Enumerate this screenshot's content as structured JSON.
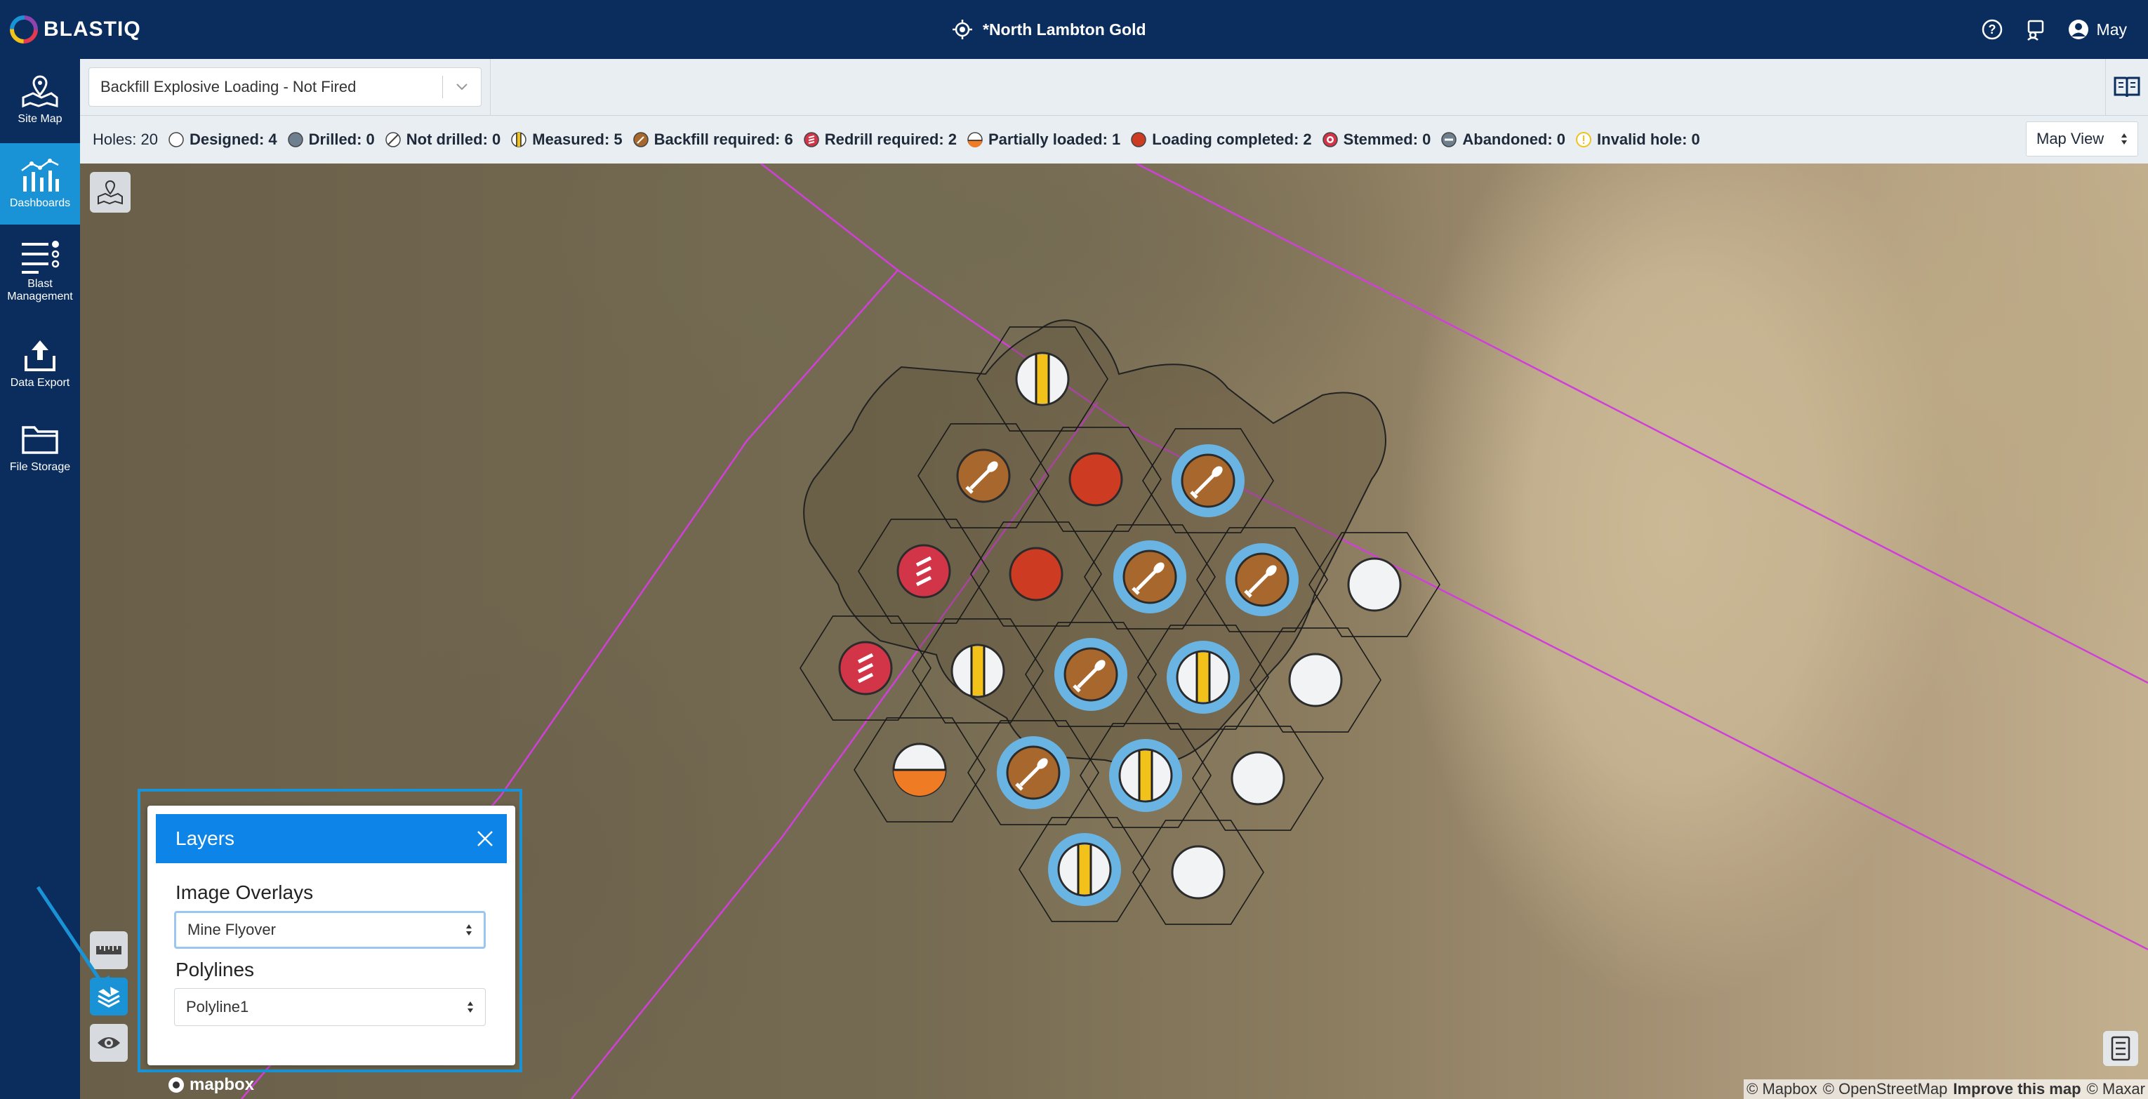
{
  "app": {
    "logo_text": "BLASTIQ",
    "site_title": "*North Lambton Gold",
    "user_name": "May"
  },
  "nav": [
    {
      "label": "Site Map",
      "icon": "site-map-icon"
    },
    {
      "label": "Dashboards",
      "icon": "dashboard-icon",
      "active": true
    },
    {
      "label": "Blast Management",
      "icon": "blast-management-icon"
    },
    {
      "label": "Data Export",
      "icon": "export-icon"
    },
    {
      "label": "File Storage",
      "icon": "folder-icon"
    }
  ],
  "controls": {
    "fire_select_value": "Backfill Explosive Loading - Not Fired",
    "map_view_value": "Map View"
  },
  "status": {
    "holes": "Holes: 20",
    "designed": "Designed: 4",
    "drilled": "Drilled: 0",
    "not_drilled": "Not drilled: 0",
    "measured": "Measured: 5",
    "backfill_required": "Backfill required: 6",
    "redrill_required": "Redrill required: 2",
    "partially_loaded": "Partially loaded: 1",
    "loading_completed": "Loading completed: 2",
    "stemmed": "Stemmed: 0",
    "abandoned": "Abandoned: 0",
    "invalid_hole": "Invalid hole: 0"
  },
  "colors": {
    "header": "#0b2d5e",
    "active_nav": "#1a93d6",
    "backfill": "#a8672c",
    "redrill": "#d33548",
    "loaded": "#cc3b22",
    "measured_stripe": "#f2c21a",
    "partially_loaded": "#ef7b24",
    "highlight_ring": "#6ab4e3",
    "polyline": "#d040d8"
  },
  "layers": {
    "title": "Layers",
    "image_overlays_label": "Image Overlays",
    "image_overlay_value": "Mine Flyover",
    "polylines_label": "Polylines",
    "polyline_value": "Polyline1"
  },
  "map": {
    "attribution_mapbox": "© Mapbox",
    "attribution_osm": "© OpenStreetMap",
    "attribution_improve": "Improve this map",
    "attribution_maxar": "© Maxar",
    "mapbox_logo": "mapbox"
  },
  "holes": [
    {
      "status": "measured",
      "highlight": false
    },
    {
      "status": "backfill",
      "highlight": false
    },
    {
      "status": "loaded",
      "highlight": false
    },
    {
      "status": "backfill",
      "highlight": true
    },
    {
      "status": "redrill",
      "highlight": false
    },
    {
      "status": "loaded",
      "highlight": false
    },
    {
      "status": "backfill",
      "highlight": true
    },
    {
      "status": "backfill",
      "highlight": true
    },
    {
      "status": "designed",
      "highlight": false
    },
    {
      "status": "redrill",
      "highlight": false
    },
    {
      "status": "measured",
      "highlight": false
    },
    {
      "status": "backfill",
      "highlight": true
    },
    {
      "status": "measured",
      "highlight": true
    },
    {
      "status": "designed",
      "highlight": false
    },
    {
      "status": "partial",
      "highlight": false
    },
    {
      "status": "backfill",
      "highlight": true
    },
    {
      "status": "measured",
      "highlight": true
    },
    {
      "status": "designed",
      "highlight": false
    },
    {
      "status": "measured",
      "highlight": true
    },
    {
      "status": "designed",
      "highlight": false
    }
  ]
}
